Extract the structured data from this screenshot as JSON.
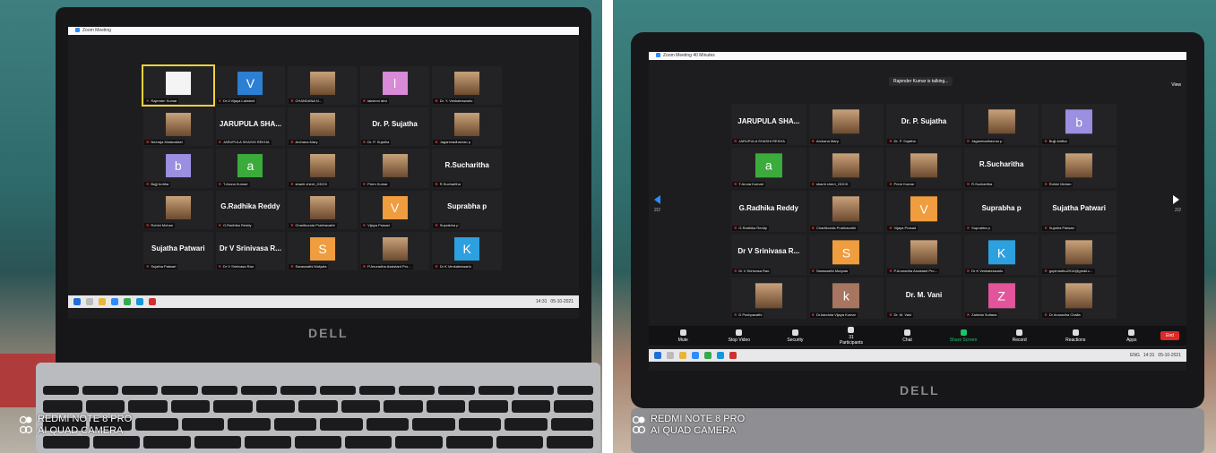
{
  "left": {
    "window_title": "Zoom Meeting",
    "taskbar_clock": "14:31",
    "taskbar_date": "05-10-2021",
    "tiles": [
      {
        "big": "",
        "caption": "Rajender Kumar",
        "avatar_color": "#f4f4f4",
        "letter": "",
        "type": "active"
      },
      {
        "big": "",
        "caption": "Dr.V.Vijaya Lakshmi",
        "avatar_color": "#2d7fd4",
        "letter": "V",
        "type": "letter"
      },
      {
        "big": "",
        "caption": "CHANDANA N...",
        "avatar_color": "",
        "letter": "",
        "type": "photo"
      },
      {
        "big": "",
        "caption": "lakshmi devi",
        "avatar_color": "#d98ad8",
        "letter": "l",
        "type": "letter"
      },
      {
        "big": "",
        "caption": "Dr. Y. Venkateswarlu",
        "avatar_color": "",
        "letter": "",
        "type": "photo"
      },
      {
        "big": "",
        "caption": "Neeraja Mulanakkel",
        "avatar_color": "",
        "letter": "",
        "type": "photo"
      },
      {
        "big": "JARUPULA SHA...",
        "caption": "JARUPULA SHASHI REKHA",
        "avatar_color": "",
        "letter": "",
        "type": "name"
      },
      {
        "big": "",
        "caption": "Archana Mary",
        "avatar_color": "",
        "letter": "",
        "type": "photo"
      },
      {
        "big": "Dr. P. Sujatha",
        "caption": "Dr. P. Sujatha",
        "avatar_color": "",
        "letter": "",
        "type": "name"
      },
      {
        "big": "",
        "caption": "Jaganmadhavrao p",
        "avatar_color": "",
        "letter": "",
        "type": "photo"
      },
      {
        "big": "",
        "caption": "Bujji Anitha",
        "avatar_color": "#9a8fe0",
        "letter": "b",
        "type": "letter"
      },
      {
        "big": "",
        "caption": "T.Aruna Kumari",
        "avatar_color": "#3bab3b",
        "letter": "a",
        "type": "letter"
      },
      {
        "big": "",
        "caption": "shanti cherri_GDCK",
        "avatar_color": "",
        "letter": "",
        "type": "photo"
      },
      {
        "big": "",
        "caption": "Prem Kumar",
        "avatar_color": "",
        "letter": "",
        "type": "photo"
      },
      {
        "big": "R.Sucharitha",
        "caption": "R.Sucharitha",
        "avatar_color": "",
        "letter": "",
        "type": "name"
      },
      {
        "big": "",
        "caption": "Rohini Mohan",
        "avatar_color": "",
        "letter": "",
        "type": "photo"
      },
      {
        "big": "G.Radhika Reddy",
        "caption": "G.Radhika Reddy",
        "avatar_color": "",
        "letter": "",
        "type": "name"
      },
      {
        "big": "",
        "caption": "Charitkonda Prabhavathi",
        "avatar_color": "",
        "letter": "",
        "type": "photo"
      },
      {
        "big": "",
        "caption": "Vijaya Prasad",
        "avatar_color": "#ef9d3f",
        "letter": "V",
        "type": "letter"
      },
      {
        "big": "Suprabha p",
        "caption": "Suprabha p",
        "avatar_color": "",
        "letter": "",
        "type": "name"
      },
      {
        "big": "Sujatha Patwari",
        "caption": "Sujatha Patwari",
        "avatar_color": "",
        "letter": "",
        "type": "name"
      },
      {
        "big": "Dr V Srinivasa R...",
        "caption": "Dr V Srinivasa Rao",
        "avatar_color": "",
        "letter": "",
        "type": "name"
      },
      {
        "big": "",
        "caption": "Saraswathi Mutyala",
        "avatar_color": "#ef9d3f",
        "letter": "S",
        "type": "letter"
      },
      {
        "big": "",
        "caption": "P.Anuradha Assistant Pro...",
        "avatar_color": "",
        "letter": "",
        "type": "photo"
      },
      {
        "big": "",
        "caption": "Dr K Venkateswarlu",
        "avatar_color": "#2da0e0",
        "letter": "K",
        "type": "letter"
      }
    ]
  },
  "right": {
    "window_title": "Zoom Meeting 40 Minutes",
    "talking": "Rajender Kumar is talking...",
    "view_label": "View",
    "page_indicator": "2/2",
    "taskbar_clock": "14:31",
    "taskbar_date": "05-10-2021",
    "taskbar_lang": "ENG",
    "participants_count": "31",
    "controls": [
      "Mute",
      "Stop Video",
      "Security",
      "Participants",
      "Chat",
      "Share Screen",
      "Record",
      "Reactions",
      "Apps"
    ],
    "end_label": "End",
    "tiles": [
      {
        "big": "JARUPULA SHA...",
        "caption": "JARUPULA SHASHI REKHA",
        "avatar_color": "",
        "letter": "",
        "type": "name"
      },
      {
        "big": "",
        "caption": "Archana Mary",
        "avatar_color": "",
        "letter": "",
        "type": "photo"
      },
      {
        "big": "Dr. P. Sujatha",
        "caption": "Dr. P. Sujatha",
        "avatar_color": "",
        "letter": "",
        "type": "name"
      },
      {
        "big": "",
        "caption": "Jaganmadhavrao p",
        "avatar_color": "",
        "letter": "",
        "type": "photo"
      },
      {
        "big": "",
        "caption": "Bujji Anitha",
        "avatar_color": "#9a8fe0",
        "letter": "b",
        "type": "letter"
      },
      {
        "big": "",
        "caption": "T.Aruna Kumari",
        "avatar_color": "#3bab3b",
        "letter": "a",
        "type": "letter"
      },
      {
        "big": "",
        "caption": "shanti cherri_GDCK",
        "avatar_color": "",
        "letter": "",
        "type": "photo"
      },
      {
        "big": "",
        "caption": "Prem Kumar",
        "avatar_color": "",
        "letter": "",
        "type": "photo"
      },
      {
        "big": "R.Sucharitha",
        "caption": "R.Sucharitha",
        "avatar_color": "",
        "letter": "",
        "type": "name"
      },
      {
        "big": "",
        "caption": "Rohini Mohan",
        "avatar_color": "",
        "letter": "",
        "type": "photo"
      },
      {
        "big": "G.Radhika Reddy",
        "caption": "G.Radhika Reddy",
        "avatar_color": "",
        "letter": "",
        "type": "name"
      },
      {
        "big": "",
        "caption": "Charitkonda Prabhavathi",
        "avatar_color": "",
        "letter": "",
        "type": "photo"
      },
      {
        "big": "",
        "caption": "Vijaya Prasad",
        "avatar_color": "#ef9d3f",
        "letter": "V",
        "type": "letter"
      },
      {
        "big": "Suprabha p",
        "caption": "Suprabha p",
        "avatar_color": "",
        "letter": "",
        "type": "name"
      },
      {
        "big": "Sujatha Patwari",
        "caption": "Sujatha Patwari",
        "avatar_color": "",
        "letter": "",
        "type": "name"
      },
      {
        "big": "Dr V Srinivasa R...",
        "caption": "Dr V Srinivasa Rao",
        "avatar_color": "",
        "letter": "",
        "type": "name"
      },
      {
        "big": "",
        "caption": "Saraswathi Mutyala",
        "avatar_color": "#ef9d3f",
        "letter": "S",
        "type": "letter"
      },
      {
        "big": "",
        "caption": "P.Anuradha Assistant Pro...",
        "avatar_color": "",
        "letter": "",
        "type": "photo"
      },
      {
        "big": "",
        "caption": "Dr K Venkateswarlu",
        "avatar_color": "#2da0e0",
        "letter": "K",
        "type": "letter"
      },
      {
        "big": "",
        "caption": "gopimadhu2014@gmail.c...",
        "avatar_color": "",
        "letter": "",
        "type": "photo"
      },
      {
        "big": "",
        "caption": "D Pushpavathi",
        "avatar_color": "",
        "letter": "",
        "type": "photo"
      },
      {
        "big": "",
        "caption": "Dr.kandula Vijaya Kumar",
        "avatar_color": "#a87560",
        "letter": "k",
        "type": "letter"
      },
      {
        "big": "Dr. M. Vani",
        "caption": "Dr. M. Vani",
        "avatar_color": "",
        "letter": "",
        "type": "name"
      },
      {
        "big": "",
        "caption": "Zaheda Sultana",
        "avatar_color": "#e2559a",
        "letter": "Z",
        "type": "letter"
      },
      {
        "big": "",
        "caption": "Dr Anuradha Challa",
        "avatar_color": "",
        "letter": "",
        "type": "photo"
      }
    ]
  },
  "brand": "DELL",
  "watermark_line1": "REDMI NOTE 8 PRO",
  "watermark_line2": "AI QUAD CAMERA"
}
